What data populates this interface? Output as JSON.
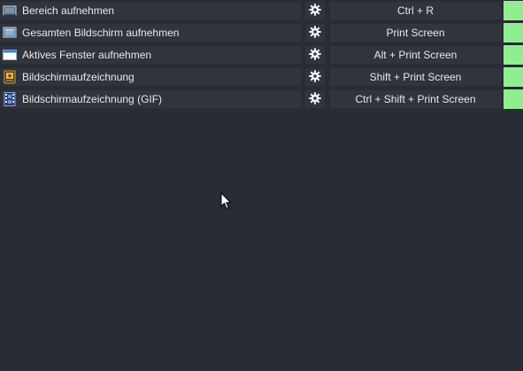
{
  "rows": [
    {
      "label": "Bereich aufnehmen",
      "icon": "region-capture-icon",
      "hotkey": "Ctrl + R",
      "status_color": "#90ee90"
    },
    {
      "label": "Gesamten Bildschirm aufnehmen",
      "icon": "fullscreen-capture-icon",
      "hotkey": "Print Screen",
      "status_color": "#90ee90"
    },
    {
      "label": "Aktives Fenster aufnehmen",
      "icon": "window-capture-icon",
      "hotkey": "Alt + Print Screen",
      "status_color": "#90ee90"
    },
    {
      "label": "Bildschirmaufzeichnung",
      "icon": "screen-recording-icon",
      "hotkey": "Shift + Print Screen",
      "status_color": "#90ee90"
    },
    {
      "label": "Bildschirmaufzeichnung (GIF)",
      "icon": "gif-recording-icon",
      "hotkey": "Ctrl + Shift + Print Screen",
      "status_color": "#90ee90"
    }
  ],
  "settings_icon": "gear-icon",
  "colors": {
    "background": "#282c34",
    "cell": "#31343d",
    "status_ok": "#90ee90"
  }
}
